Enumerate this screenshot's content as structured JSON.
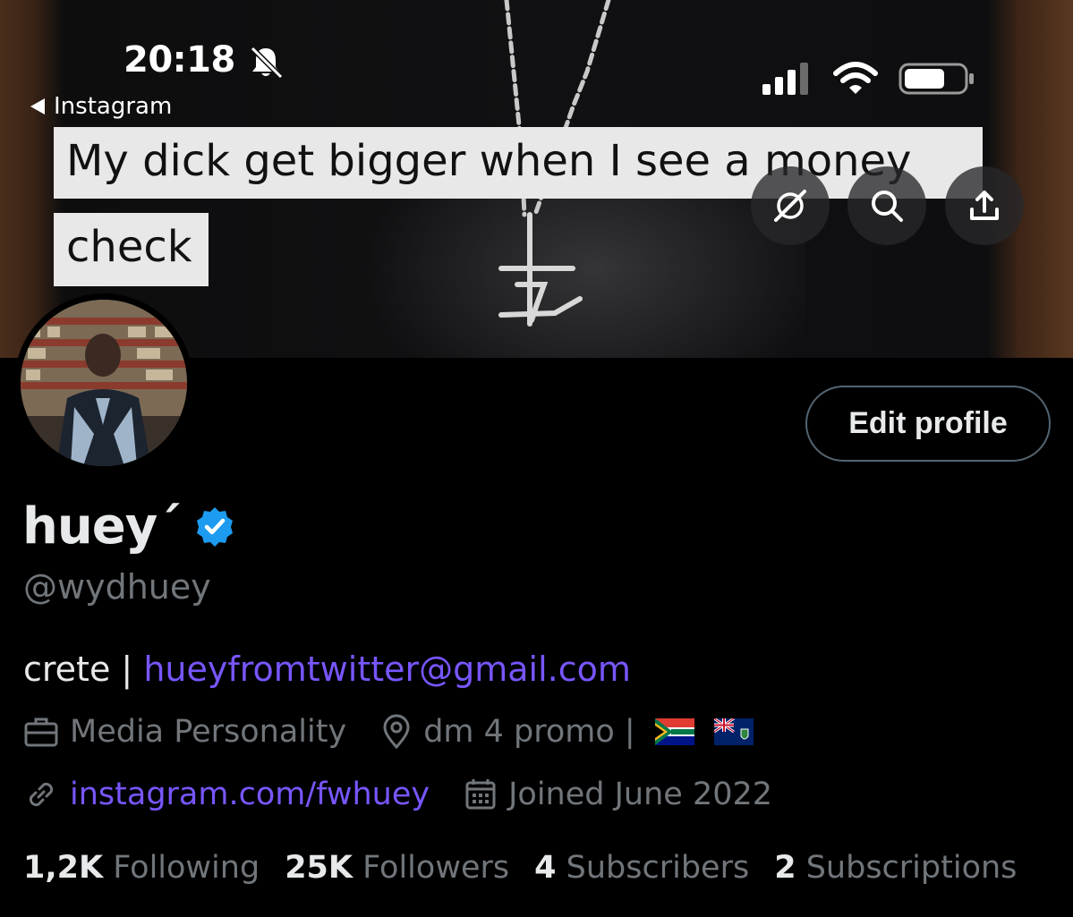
{
  "status_bar": {
    "time": "20:18",
    "back_app": "Instagram",
    "icons": [
      "bell-slash-icon",
      "cellular-signal-icon",
      "wifi-icon",
      "battery-icon"
    ]
  },
  "banner": {
    "caption_line1": "My dick get bigger when I see a money",
    "caption_line2": "check",
    "buttons": [
      "grok-icon",
      "search-icon",
      "share-icon"
    ]
  },
  "profile": {
    "edit_label": "Edit profile",
    "display_name": "huey´",
    "handle": "@wydhuey",
    "bio_text": "crete",
    "bio_separator": " | ",
    "bio_email": "hueyfromtwitter@gmail.com",
    "category": "Media Personality",
    "location": "dm 4 promo |",
    "location_flags": [
      "south-africa-flag",
      "british-virgin-islands-flag"
    ],
    "website": "instagram.com/fwhuey",
    "joined": "Joined June 2022"
  },
  "stats": [
    {
      "value": "1,2K",
      "label": "Following"
    },
    {
      "value": "25K",
      "label": "Followers"
    },
    {
      "value": "4",
      "label": "Subscribers"
    },
    {
      "value": "2",
      "label": "Subscriptions"
    }
  ],
  "colors": {
    "background": "#000000",
    "text_primary": "#e7e9ea",
    "text_secondary": "#71767b",
    "link": "#7856ff",
    "verified": "#1d9bf0",
    "button_border": "#536471"
  }
}
